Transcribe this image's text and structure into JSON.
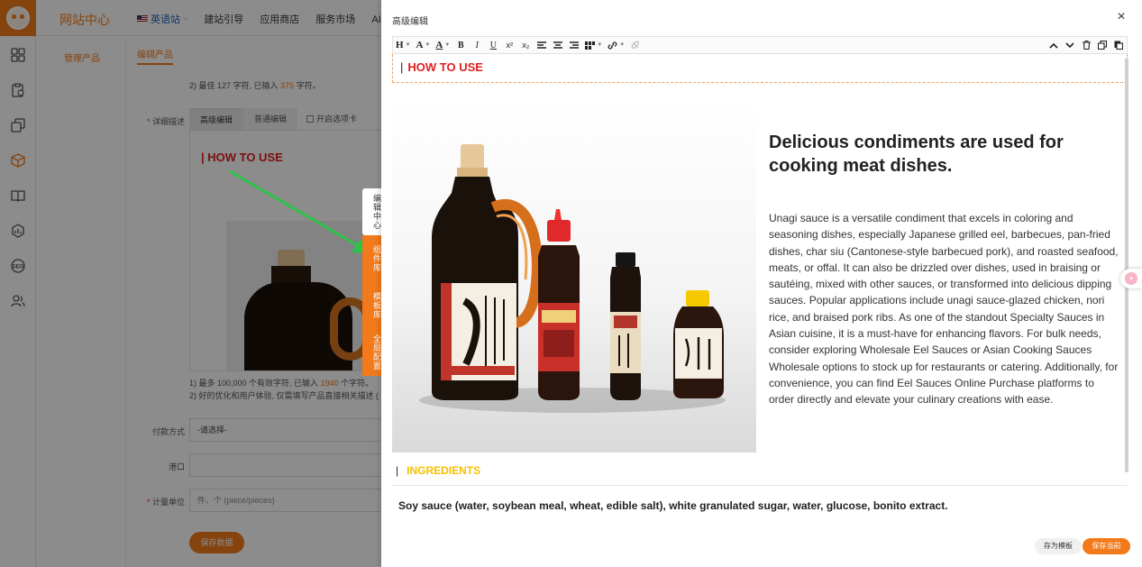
{
  "app": {
    "site_title": "网站中心",
    "nav": [
      {
        "label": "英语站"
      },
      {
        "label": "建站引导"
      },
      {
        "label": "应用商店"
      },
      {
        "label": "服务市场"
      },
      {
        "label": "AI助手"
      }
    ],
    "sub_nav": {
      "item": "管理产品"
    },
    "page_tab": "编辑产品",
    "notes": {
      "top_line": "2)  最佳 127 字符, 已输入",
      "top_count": "375",
      "top_tail": "字符。",
      "bottom_line1": "1)  最多 100,000 个有效字符, 已输入",
      "bottom_count": "1940",
      "bottom_tail1": "个字符。",
      "bottom_line2": "2)  好的优化和用户体验, 仅需填写产品直接相关描述 ("
    },
    "form": {
      "desc_label": "详细描述",
      "editor_tabs": [
        "高级编辑",
        "普通编辑"
      ],
      "open_tab_option": "开启选项卡",
      "payment_label": "付款方式",
      "payment_value": "-请选择-",
      "port_label": "港口",
      "unit_label": "计量单位",
      "unit_placeholder": "件、个 (piece/pieces)",
      "save_button": "保存数据"
    },
    "preview_heading": "HOW TO USE",
    "side_tabs": [
      "编辑中心",
      "组件库",
      "模板库",
      "全局配置"
    ]
  },
  "drawer": {
    "title": "高级编辑",
    "close": "×",
    "toolbar": {
      "heading": "H",
      "bold": "B",
      "italic": "I",
      "underline": "U",
      "superscript": "x²",
      "subscript": "x₂"
    },
    "section1_heading": "HOW TO USE",
    "headline": "Delicious condiments are used for cooking meat dishes.",
    "paragraph": "Unagi sauce is a versatile condiment that excels in coloring and seasoning dishes, especially Japanese grilled eel, barbecues, pan-fried dishes, char siu (Cantonese-style barbecued pork), and roasted seafood, meats, or offal. It can also be drizzled over dishes, used in braising or sautéing, mixed with other sauces, or transformed into delicious dipping sauces. Popular applications include unagi sauce-glazed chicken, nori rice, and braised pork ribs. As one of the standout Specialty Sauces in Asian cuisine, it is a must-have for enhancing flavors. For bulk needs, consider exploring Wholesale Eel Sauces or Asian Cooking Sauces Wholesale options to stock up for restaurants or catering. Additionally, for convenience, you can find Eel Sauces Online Purchase platforms to order directly and elevate your culinary creations with ease.",
    "section2_heading": "INGREDIENTS",
    "ingredients": "Soy sauce (water, soybean meal, wheat, edible salt), white granulated sugar, water, glucose, bonito extract.",
    "save_as_template": "存为模板",
    "save_current": "保存当前"
  },
  "colors": {
    "accent": "#f27a1a",
    "heading_red": "#e02020",
    "heading_yellow": "#f5c000"
  }
}
